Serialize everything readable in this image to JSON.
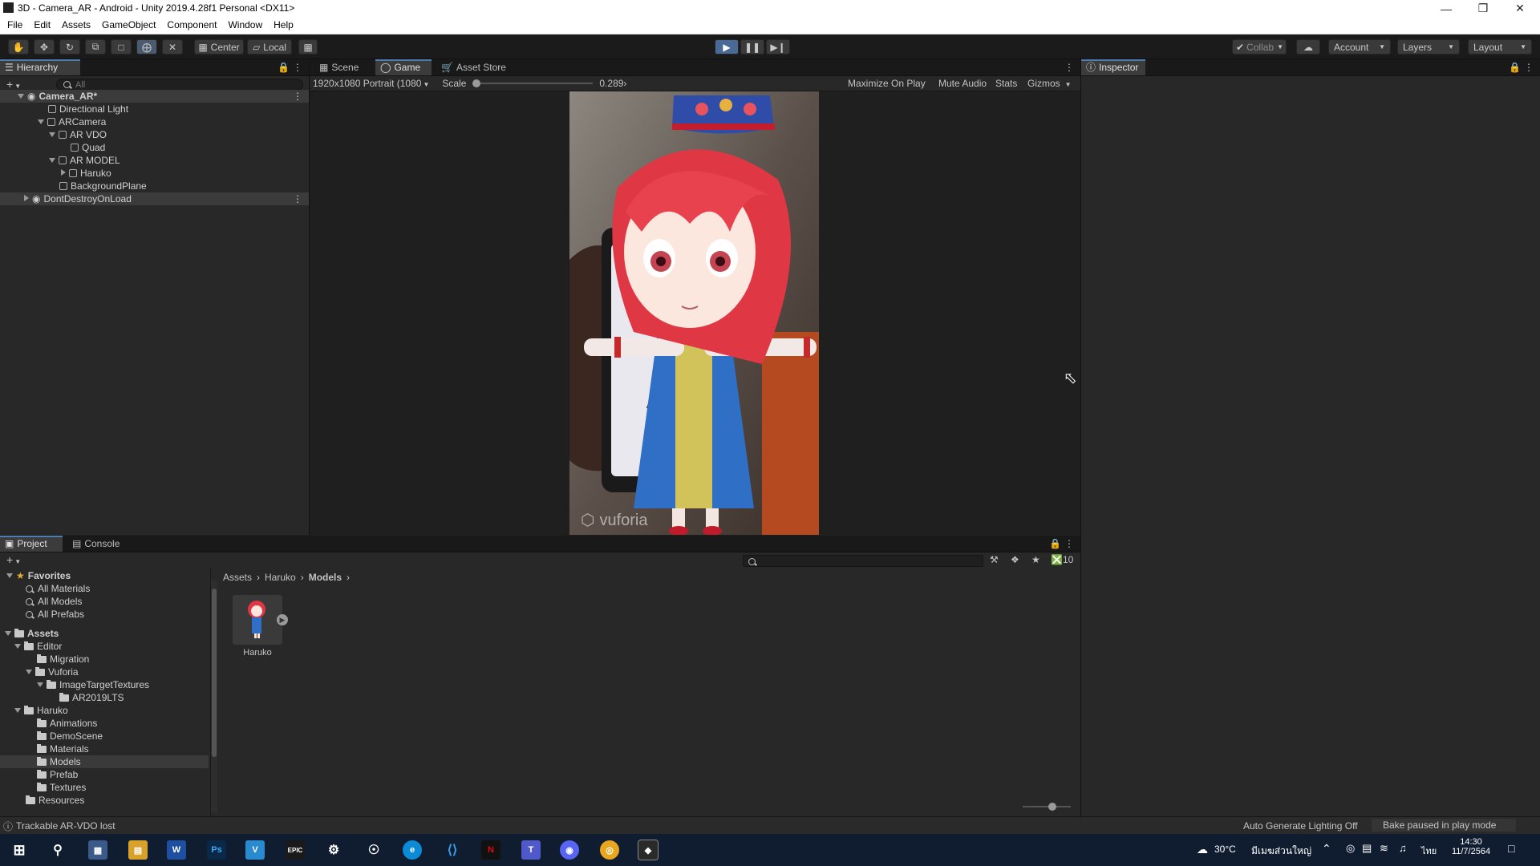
{
  "window": {
    "title": "3D - Camera_AR - Android - Unity 2019.4.28f1 Personal <DX11>"
  },
  "menu": [
    "File",
    "Edit",
    "Assets",
    "GameObject",
    "Component",
    "Window",
    "Help"
  ],
  "toolbar": {
    "center_label": "Center",
    "local_label": "Local",
    "collab_label": "Collab",
    "account_label": "Account",
    "layers_label": "Layers",
    "layout_label": "Layout"
  },
  "hierarchy": {
    "tab_label": "Hierarchy",
    "search_placeholder": "All",
    "items": [
      {
        "label": "Camera_AR*",
        "depth": 0
      },
      {
        "label": "Directional Light",
        "depth": 1
      },
      {
        "label": "ARCamera",
        "depth": 1
      },
      {
        "label": "AR VDO",
        "depth": 2
      },
      {
        "label": "Quad",
        "depth": 3
      },
      {
        "label": "AR MODEL",
        "depth": 2
      },
      {
        "label": "Haruko",
        "depth": 3
      },
      {
        "label": "BackgroundPlane",
        "depth": 2
      },
      {
        "label": "DontDestroyOnLoad",
        "depth": 0
      }
    ]
  },
  "center": {
    "tabs": [
      "Scene",
      "Game",
      "Asset Store"
    ],
    "resolution": "1920x1080 Portrait (1080",
    "scale_label": "Scale",
    "scale_value": "0.289",
    "maximize_label": "Maximize On Play",
    "mute_label": "Mute Audio",
    "stats_label": "Stats",
    "gizmos_label": "Gizmos",
    "watermark": "vuforia"
  },
  "inspector": {
    "tab_label": "Inspector"
  },
  "project": {
    "tabs": [
      "Project",
      "Console"
    ],
    "favorites_label": "Favorites",
    "favorites": [
      "All Materials",
      "All Models",
      "All Prefabs"
    ],
    "assets_label": "Assets",
    "tree": [
      {
        "label": "Editor",
        "depth": 1,
        "open": true
      },
      {
        "label": "Migration",
        "depth": 2
      },
      {
        "label": "Vuforia",
        "depth": 2,
        "open": true
      },
      {
        "label": "ImageTargetTextures",
        "depth": 3,
        "open": true
      },
      {
        "label": "AR2019LTS",
        "depth": 4
      },
      {
        "label": "Haruko",
        "depth": 1,
        "open": true
      },
      {
        "label": "Animations",
        "depth": 2
      },
      {
        "label": "DemoScene",
        "depth": 2
      },
      {
        "label": "Materials",
        "depth": 2
      },
      {
        "label": "Models",
        "depth": 2,
        "selected": true
      },
      {
        "label": "Prefab",
        "depth": 2
      },
      {
        "label": "Textures",
        "depth": 2
      },
      {
        "label": "Resources",
        "depth": 1
      }
    ],
    "breadcrumb": [
      "Assets",
      "Haruko",
      "Models"
    ],
    "asset_name": "Haruko",
    "hidden_count": "10"
  },
  "status": {
    "message": "Trackable AR-VDO lost",
    "lighting": "Auto Generate Lighting Off",
    "bake": "Bake paused in play mode"
  },
  "taskbar": {
    "weather": "30°C",
    "weather_text": "มีเมฆส่วนใหญ่",
    "lang": "ไทย",
    "time": "14:30",
    "date": "11/7/2564"
  }
}
